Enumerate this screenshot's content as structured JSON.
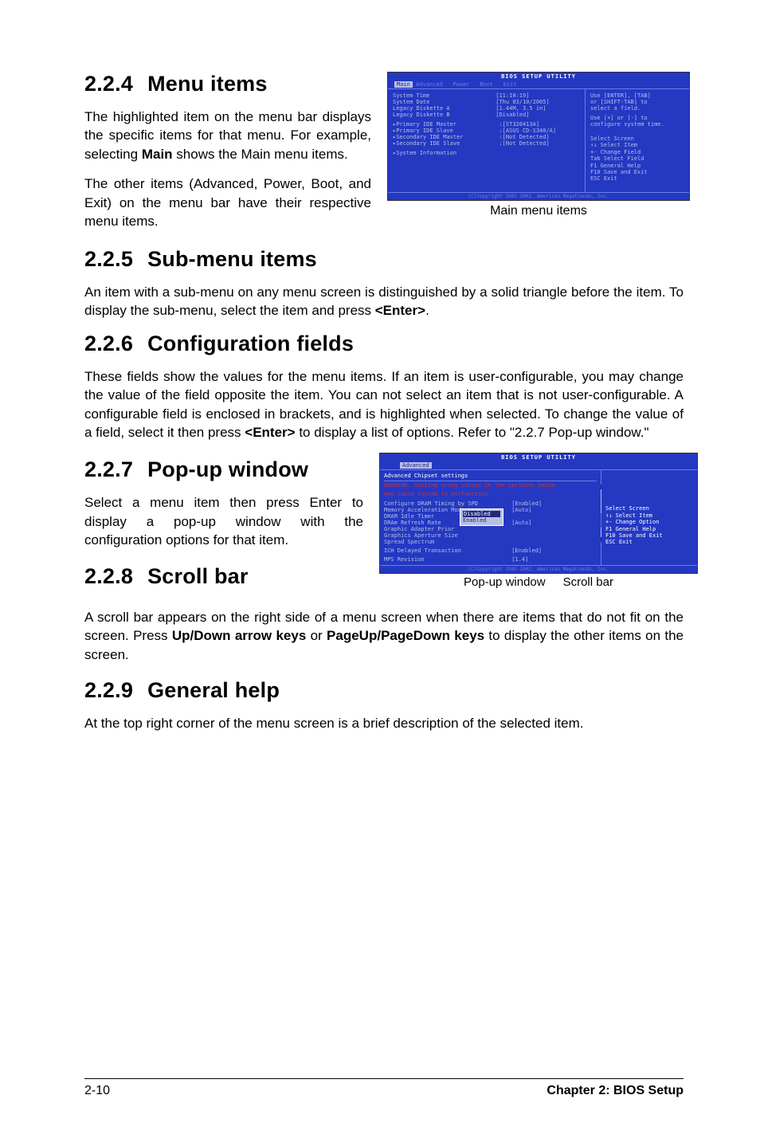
{
  "sections": {
    "s224": {
      "num": "2.2.4",
      "title": "Menu items"
    },
    "s225": {
      "num": "2.2.5",
      "title": "Sub-menu items"
    },
    "s226": {
      "num": "2.2.6",
      "title": "Configuration fields"
    },
    "s227": {
      "num": "2.2.7",
      "title": "Pop-up window"
    },
    "s228": {
      "num": "2.2.8",
      "title": "Scroll bar"
    },
    "s229": {
      "num": "2.2.9",
      "title": "General help"
    }
  },
  "paras": {
    "p224a_1": "The highlighted item on the menu bar  displays the specific items for that menu. For example, selecting ",
    "p224a_bold": "Main",
    "p224a_2": " shows the Main menu items.",
    "p224b": "The other items (Advanced, Power, Boot, and Exit) on the menu bar have their respective menu items.",
    "p225_1": "An item with a sub-menu on any menu screen is distinguished by a solid triangle before the item. To display the sub-menu, select the item and press ",
    "p225_bold": "<Enter>",
    "p225_2": ".",
    "p226_1": "These fields show the values for the menu items. If an item is user-configurable, you may change the value of the field opposite the item. You can not select an item that is not user-configurable. A configurable field is enclosed in brackets, and is highlighted when selected. To change the value of a field, select it then press ",
    "p226_bold": "<Enter>",
    "p226_2": " to display a list of options. Refer to \"2.2.7 Pop-up window.\"",
    "p227": "Select a menu item then press Enter to display a pop-up window with the configuration options for that item.",
    "p228_1": "A scroll bar appears on the right side of a menu screen when there are items that do not fit on the screen. Press ",
    "p228_b1": "Up/Down arrow keys",
    "p228_2": " or ",
    "p228_b2": "PageUp/PageDown keys",
    "p228_3": " to display the other items on the screen.",
    "p229": "At the top right corner of the menu screen is a brief description of the selected item."
  },
  "captions": {
    "main": "Main menu items",
    "popup": "Pop-up window",
    "scroll": "Scroll bar"
  },
  "bios_main": {
    "title": "BIOS SETUP UTILITY",
    "tabs": [
      "Main",
      "Advanced",
      "Power",
      "Boot",
      "Exit"
    ],
    "fields": [
      {
        "k": "System Time",
        "v": "[11:10:19]"
      },
      {
        "k": "System Date",
        "v": "[Thu 03/10/2005]"
      },
      {
        "k": "Legacy Diskette A",
        "v": "[1.44M, 3.5 in]"
      },
      {
        "k": "Legacy Diskette B",
        "v": "[Disabled]"
      }
    ],
    "submenus": [
      {
        "k": "Primary IDE Master",
        "v": ":[ST320413A]"
      },
      {
        "k": "Primary IDE Slave",
        "v": ":[ASUS CD-S340/A]"
      },
      {
        "k": "Secondary IDE Master",
        "v": ":[Not Detected]"
      },
      {
        "k": "Secondary IDE Slave",
        "v": ":[Not Detected]"
      }
    ],
    "last": "System Information",
    "help1": "Use [ENTER], [TAB]",
    "help2": "or [SHIFT-TAB] to",
    "help3": "select a field.",
    "help4": "Use [+] or [-] to",
    "help5": "configure system time.",
    "navkeys": [
      "    Select Screen",
      "↑↓  Select Item",
      "+-  Change Field",
      "Tab Select Field",
      "F1  General Help",
      "F10 Save and Exit",
      "ESC Exit"
    ],
    "copyright": "(C)Copyright 1985-2002, American Megatrends, Inc."
  },
  "bios_adv": {
    "title": "BIOS SETUP UTILITY",
    "tab": "Advanced",
    "subtitle": "Advanced Chipset settings",
    "warn1": "WARNING: Setting wrong values in the sections below",
    "warn2": "         may cause system to malfunction.",
    "fields": [
      {
        "k": "Configure DRAM Timing by SPD",
        "v": "[Enabled]"
      },
      {
        "k": "Memory Acceleration Mode",
        "v": "[Auto]"
      },
      {
        "k": "DRAM Idle Timer",
        "v": ""
      },
      {
        "k": "DRAm Refresh Rate",
        "v": "[Auto]"
      },
      {
        "k": "",
        "v": ""
      },
      {
        "k": "Graphic Adapter Prior",
        "v": ""
      },
      {
        "k": "Graphics Aperture Size",
        "v": ""
      },
      {
        "k": "Spread Spectrum",
        "v": ""
      },
      {
        "k": "",
        "v": ""
      },
      {
        "k": "ICH Delayed Transaction",
        "v": "[Enabled]"
      },
      {
        "k": "",
        "v": ""
      },
      {
        "k": "MPS Revision",
        "v": "[1.4]"
      }
    ],
    "popup_opts": [
      "Disabled",
      "Enabled"
    ],
    "navkeys": [
      "    Select Screen",
      "↑↓  Select Item",
      "+-  Change Option",
      "F1  General Help",
      "F10 Save and Exit",
      "ESC Exit"
    ],
    "copyright": "(C)Copyright 1985-2002, American Megatrends, Inc."
  },
  "footer": {
    "page": "2-10",
    "chapter": "Chapter 2: BIOS Setup"
  }
}
